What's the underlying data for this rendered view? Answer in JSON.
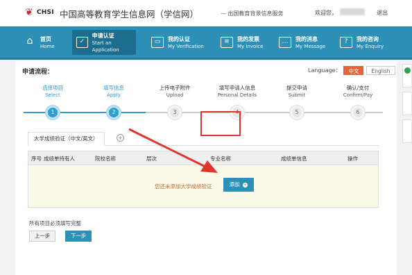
{
  "header": {
    "logo_text": "CHSI",
    "site_title": "中国高等教育学生信息网（学信网）",
    "site_subtitle": "— 出国教育背景信息服务",
    "welcome": "欢迎您，",
    "logout": "退出"
  },
  "nav": {
    "items": [
      {
        "cn": "首页",
        "en": "Home",
        "icon": "home-icon"
      },
      {
        "cn": "申请认证",
        "en": "Start an Application",
        "icon": "checkbox-icon"
      },
      {
        "cn": "我的认证",
        "en": "My Verification",
        "icon": "monitor-icon"
      },
      {
        "cn": "我的发票",
        "en": "My Invoice",
        "icon": "invoice-icon"
      },
      {
        "cn": "我的消息",
        "en": "My Message",
        "icon": "message-icon"
      },
      {
        "cn": "我的咨询",
        "en": "My Enquiry",
        "icon": "question-icon"
      }
    ]
  },
  "flow": {
    "label": "申请流程：",
    "language_label": "Language：",
    "lang_cn": "中文",
    "lang_en": "English",
    "steps": [
      {
        "cn": "选择项目",
        "en": "Select",
        "num": "1"
      },
      {
        "cn": "填写信息",
        "en": "Apply",
        "num": "2"
      },
      {
        "cn": "上传电子附件",
        "en": "Upload",
        "num": "3"
      },
      {
        "cn": "填写申请人信息",
        "en": "Personal Details",
        "num": "4"
      },
      {
        "cn": "提交申请",
        "en": "Submit",
        "num": "5"
      },
      {
        "cn": "确认/支付",
        "en": "Confirm/Pay",
        "num": "6"
      }
    ]
  },
  "tab": {
    "label": "大学成绩验证（中文/英文）",
    "add_symbol": "+"
  },
  "table": {
    "headers": [
      "序号",
      "成绩单持有人",
      "院校名称",
      "层次",
      "专业名称",
      "成绩单信息",
      "操作"
    ],
    "empty_message": "您还未添加大学成绩验证",
    "add_label": "添加",
    "add_symbol": "+"
  },
  "form": {
    "note": "所有项目必须填写完整",
    "prev_label": "上一步",
    "next_label": "下一步"
  },
  "colors": {
    "nav_bg": "#2d90b6",
    "accent": "#2d9ed0",
    "highlight_red": "#e0352f",
    "lang_active": "#e5643c"
  }
}
